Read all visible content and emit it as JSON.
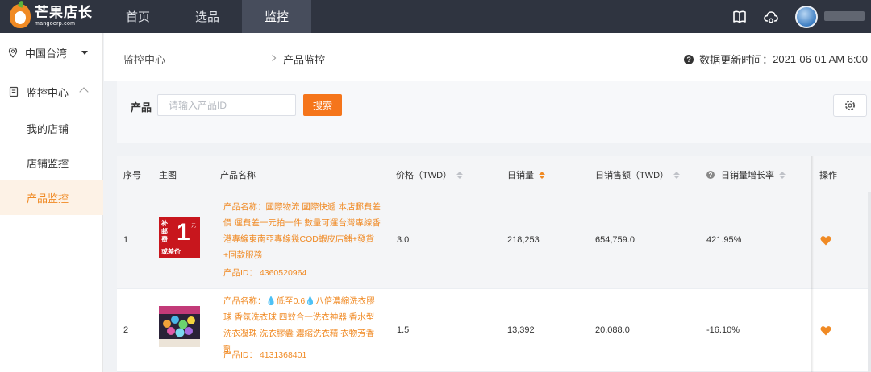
{
  "brand": {
    "name_cn": "芒果店长",
    "name_en": "mangoerp.com"
  },
  "nav": {
    "items": [
      {
        "label": "首页",
        "active": false
      },
      {
        "label": "选品",
        "active": false
      },
      {
        "label": "监控",
        "active": true
      }
    ]
  },
  "header_icons": [
    "book-icon",
    "cloud-icon"
  ],
  "sidebar": {
    "region": "中国台湾",
    "group": "监控中心",
    "items": [
      {
        "label": "我的店铺",
        "active": false
      },
      {
        "label": "店铺监控",
        "active": false
      },
      {
        "label": "产品监控",
        "active": true
      }
    ]
  },
  "breadcrumb": {
    "parent": "监控中心",
    "current": "产品监控"
  },
  "update_info": {
    "label": "数据更新时间：",
    "value": "2021-06-01 AM 6:00"
  },
  "search": {
    "label": "产品",
    "placeholder": "请输入产品ID",
    "value": "",
    "button": "搜索"
  },
  "table": {
    "columns": {
      "index": "序号",
      "image": "主图",
      "name": "产品名称",
      "price": "价格（TWD）",
      "daily_sales": "日销量",
      "daily_revenue": "日销售额（TWD）",
      "growth": "日销量增长率",
      "actions": "操作"
    },
    "sort_active": "daily_sales",
    "rows": [
      {
        "index": "1",
        "thumb_text": {
          "a": "补邮费",
          "b": "1",
          "c": "元",
          "d": "或差价"
        },
        "name": "产品名称：國際物流 國際快遞 本店郵費差價 運費差一元拍一件 數量可選台灣專線香港專線東南亞專線幾COD蝦皮店鋪+發貨+回款服務",
        "id": "产品ID： 4360520964",
        "price": "3.0",
        "daily_sales": "218,253",
        "daily_revenue": "654,759.0",
        "growth": "421.95%",
        "highlighted": true
      },
      {
        "index": "2",
        "name": "产品名称：💧低至0.6💧八倍濃縮洗衣膠球 香氛洗衣球 四效合一洗衣神器 香水型洗衣凝珠 洗衣膠囊 濃縮洗衣精 衣物芳香劑",
        "id": "产品ID： 4131368401",
        "price": "1.5",
        "daily_sales": "13,392",
        "daily_revenue": "20,088.0",
        "growth": "-16.10%",
        "highlighted": false
      }
    ]
  },
  "colors": {
    "accent": "#f08a24",
    "button": "#f5751b",
    "topbar": "#2f3440",
    "nav_active": "#474d5c"
  }
}
